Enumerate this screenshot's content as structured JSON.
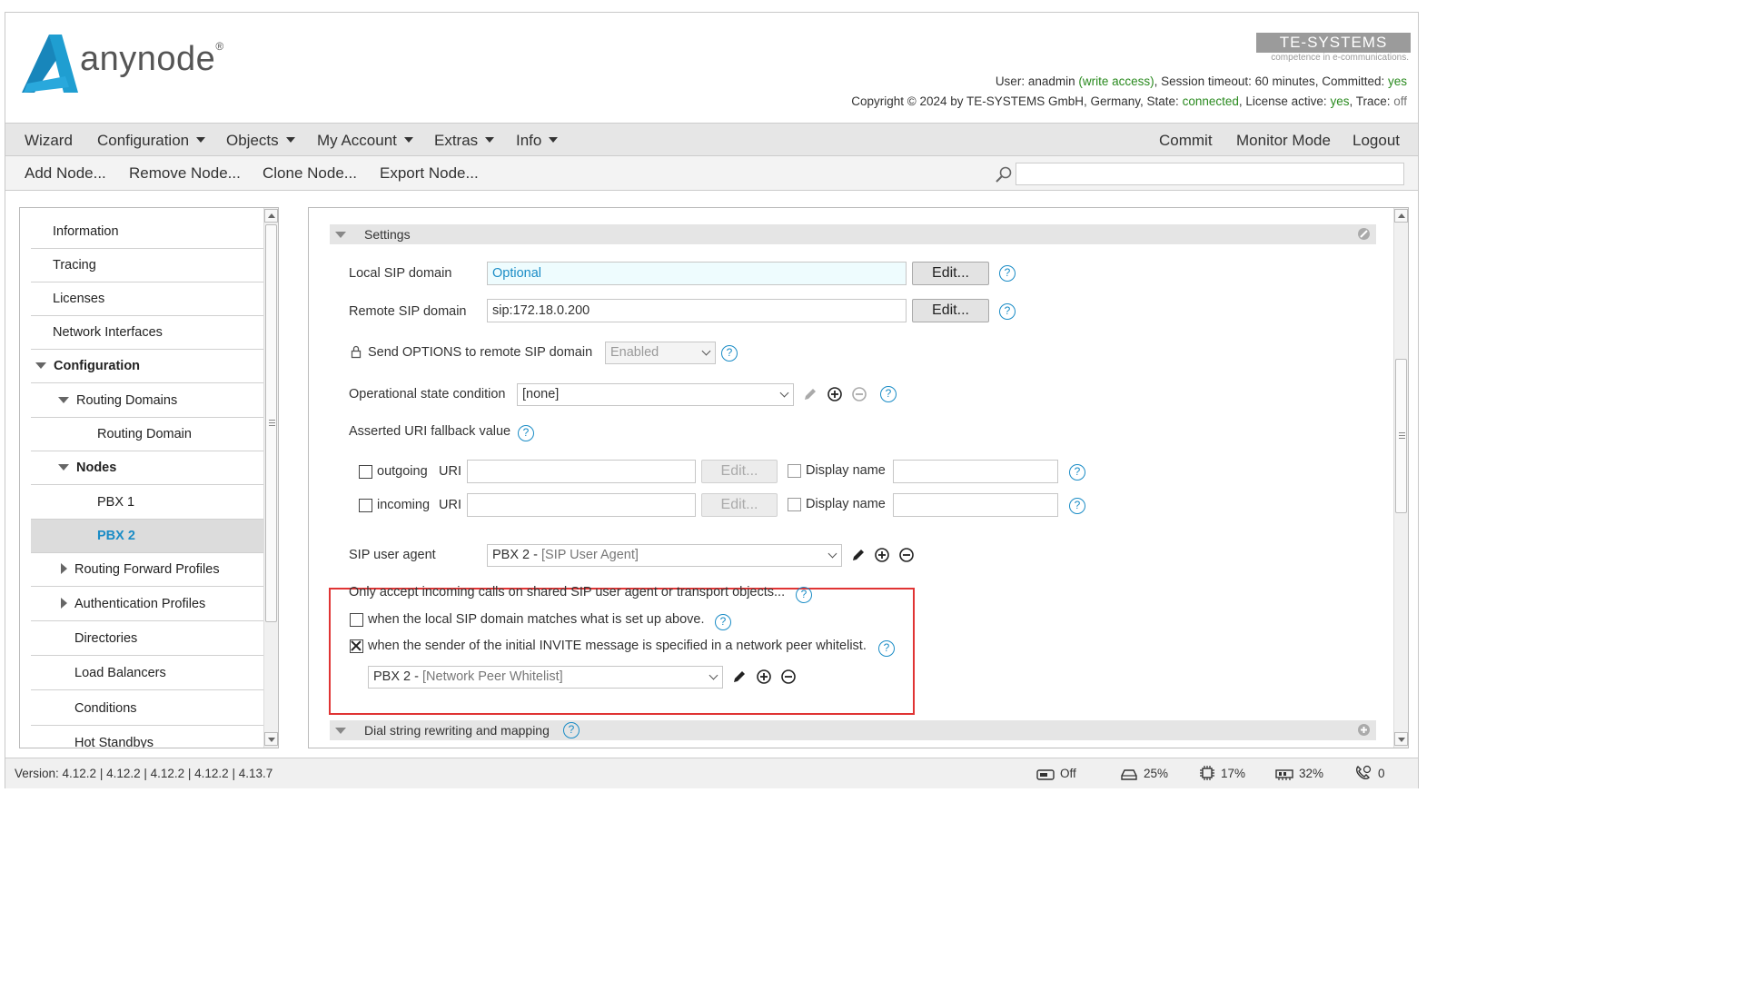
{
  "header": {
    "app_name": "anynode",
    "app_mark": "®",
    "brand": "TE-SYSTEMS",
    "brand_tagline": "competence in e-communications.",
    "user_line": {
      "user_prefix": "User: anadmin ",
      "access": "(write access)",
      "session": ", Session timeout: 60 minutes, Committed: ",
      "committed": "yes"
    },
    "copyright_line": {
      "prefix": "Copyright © 2024 by TE-SYSTEMS GmbH, Germany, State: ",
      "state": "connected",
      "license_prefix": ", License active: ",
      "license": "yes",
      "trace_prefix": ", Trace: ",
      "trace": "off"
    }
  },
  "menu": {
    "wizard": "Wizard",
    "configuration": "Configuration",
    "objects": "Objects",
    "my_account": "My Account",
    "extras": "Extras",
    "info": "Info",
    "commit": "Commit",
    "monitor_mode": "Monitor Mode",
    "logout": "Logout"
  },
  "toolbar": {
    "add_node": "Add Node...",
    "remove_node": "Remove Node...",
    "clone_node": "Clone Node...",
    "export_node": "Export Node...",
    "search_value": ""
  },
  "sidebar": {
    "items": [
      {
        "label": "Information"
      },
      {
        "label": "Tracing"
      },
      {
        "label": "Licenses"
      },
      {
        "label": "Network Interfaces"
      },
      {
        "label": "Configuration"
      },
      {
        "label": "Routing Domains"
      },
      {
        "label": "Routing Domain"
      },
      {
        "label": "Nodes"
      },
      {
        "label": "PBX 1"
      },
      {
        "label": "PBX 2"
      },
      {
        "label": "Routing Forward Profiles"
      },
      {
        "label": "Authentication Profiles"
      },
      {
        "label": "Directories"
      },
      {
        "label": "Load Balancers"
      },
      {
        "label": "Conditions"
      },
      {
        "label": "Hot Standbys"
      }
    ]
  },
  "settings": {
    "section_title": "Settings",
    "local_sip_domain": {
      "label": "Local SIP domain",
      "placeholder": "Optional",
      "button": "Edit..."
    },
    "remote_sip_domain": {
      "label": "Remote SIP domain",
      "value": "sip:172.18.0.200",
      "button": "Edit..."
    },
    "send_options": {
      "label": "Send OPTIONS to remote SIP domain",
      "value": "Enabled"
    },
    "operational_state": {
      "label": "Operational state condition",
      "value": "[none]"
    },
    "asserted_uri": {
      "label": "Asserted URI fallback value",
      "outgoing": {
        "label": "outgoing",
        "uri_label": "URI",
        "uri_value": "",
        "button": "Edit...",
        "display_label": "Display name",
        "display_value": ""
      },
      "incoming": {
        "label": "incoming",
        "uri_label": "URI",
        "uri_value": "",
        "button": "Edit...",
        "display_label": "Display name",
        "display_value": ""
      }
    },
    "sip_user_agent": {
      "label": "SIP user agent",
      "value_prefix": "PBX 2 - ",
      "value_type": "[SIP User Agent]"
    },
    "shared_accept": {
      "label": "Only accept incoming calls on shared SIP user agent or transport objects...",
      "opt_local_domain": {
        "label": "when the local SIP domain matches what is set up above.",
        "checked": false
      },
      "opt_whitelist": {
        "label": "when the sender of the initial INVITE message is specified in a network peer whitelist.",
        "checked": true
      },
      "whitelist_prefix": "PBX 2 - ",
      "whitelist_type": "[Network Peer Whitelist]"
    },
    "next_section_title": "Dial string rewriting and mapping",
    "help_glyph": "?"
  },
  "footer": {
    "version": "Version: 4.12.2 | 4.12.2 | 4.12.2 | 4.12.2 | 4.13.7",
    "standby": "Off",
    "disk": "25%",
    "cpu": "17%",
    "memory": "32%",
    "calls": "0"
  },
  "colors": {
    "accent": "#1a8cc6",
    "logo": "#1f9ed1",
    "highlight": "#e03434",
    "ok_green": "#2a8a1f"
  }
}
